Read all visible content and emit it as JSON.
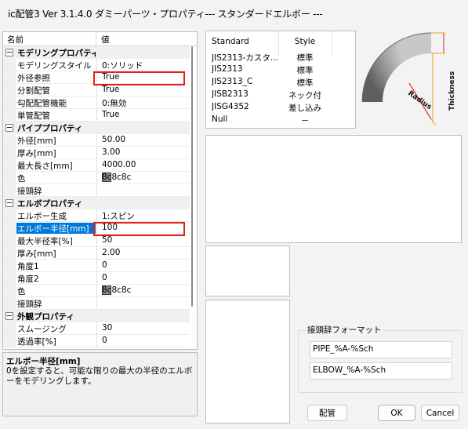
{
  "window": {
    "title": "ic配管3 Ver 3.1.4.0 ダミーパーツ・プロパティ--- スタンダードエルボー ---"
  },
  "grid": {
    "header": {
      "name": "名前",
      "value": "値"
    },
    "rows": [
      {
        "type": "category",
        "name": "モデリングプロパティ"
      },
      {
        "type": "prop",
        "name": "モデリングスタイル",
        "value": "0:ソリッド"
      },
      {
        "type": "prop",
        "name": "外径参照",
        "value": "True"
      },
      {
        "type": "prop",
        "name": "分割配管",
        "value": "True"
      },
      {
        "type": "prop",
        "name": "勾配配管機能",
        "value": "0:無効"
      },
      {
        "type": "prop",
        "name": "単管配管",
        "value": "True"
      },
      {
        "type": "category",
        "name": "パイププロパティ"
      },
      {
        "type": "prop",
        "name": "外径[mm]",
        "value": "50.00"
      },
      {
        "type": "prop",
        "name": "厚み[mm]",
        "value": "3.00"
      },
      {
        "type": "prop",
        "name": "最大長さ[mm]",
        "value": "4000.00"
      },
      {
        "type": "prop",
        "name": "色",
        "value": "8c8c8c"
      },
      {
        "type": "prop",
        "name": "接頭辞",
        "value": ""
      },
      {
        "type": "category",
        "name": "エルボプロパティ"
      },
      {
        "type": "prop",
        "name": "エルボー生成",
        "value": "1:スピン"
      },
      {
        "type": "prop",
        "name": "エルボー半径[mm]",
        "value": "100"
      },
      {
        "type": "prop",
        "name": "最大半径率[%]",
        "value": "50"
      },
      {
        "type": "prop",
        "name": "厚み[mm]",
        "value": "2.00"
      },
      {
        "type": "prop",
        "name": "角度1",
        "value": "0"
      },
      {
        "type": "prop",
        "name": "角度2",
        "value": "0"
      },
      {
        "type": "prop",
        "name": "色",
        "value": "8c8c8c"
      },
      {
        "type": "prop",
        "name": "接頭辞",
        "value": ""
      },
      {
        "type": "category",
        "name": "外観プロパティ"
      },
      {
        "type": "prop",
        "name": "スムージング",
        "value": "30"
      },
      {
        "type": "prop",
        "name": "透過率[%]",
        "value": "0"
      }
    ],
    "swatch_color": "#8c8c8c"
  },
  "description": {
    "title": "エルボー半径[mm]",
    "text": "0を設定すると、可能な限りの最大の半径のエルボーをモデリングします。"
  },
  "standard_table": {
    "headers": [
      "Standard",
      "Style"
    ],
    "rows": [
      [
        "JIS2313-カスタ...",
        "標準"
      ],
      [
        "JIS2313",
        "標準"
      ],
      [
        "JIS2313_C",
        "標準"
      ],
      [
        "JISB2313",
        "ネック付"
      ],
      [
        "JISG4352",
        "差し込み"
      ],
      [
        "Null",
        "－"
      ]
    ]
  },
  "elbow_image": {
    "radius_label": "Radius",
    "thickness_label": "Thickness",
    "accent": "#e0201e",
    "dim_color": "#f0a020"
  },
  "prefix_format": {
    "title": "接頭辞フォーマット",
    "pipe": "PIPE_%A-%Sch",
    "elbow": "ELBOW_%A-%Sch"
  },
  "buttons": {
    "haikan": "配管",
    "ok": "OK",
    "cancel": "Cancel"
  }
}
